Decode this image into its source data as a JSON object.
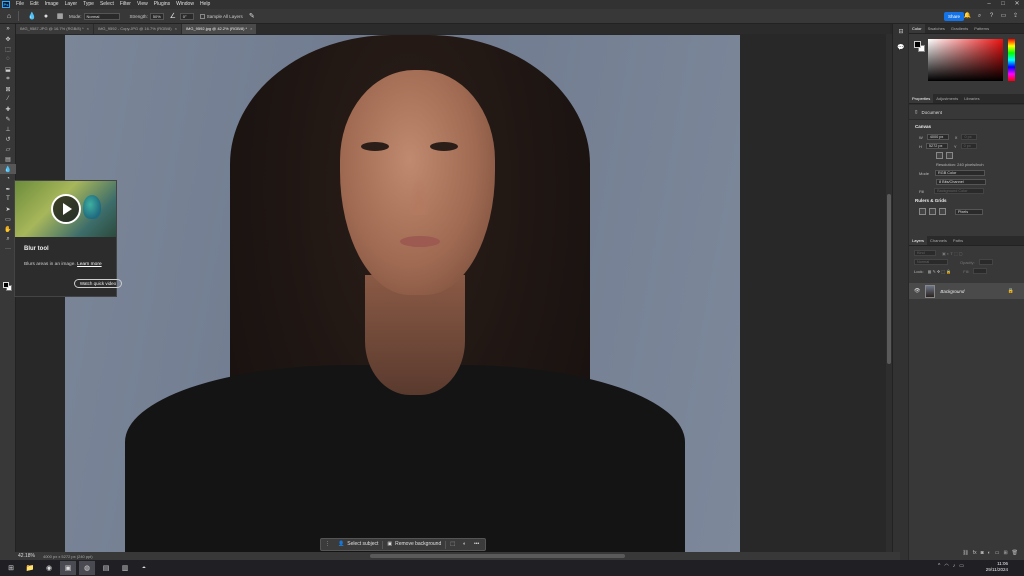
{
  "app": {
    "logo": "Ps"
  },
  "menu": [
    "File",
    "Edit",
    "Image",
    "Layer",
    "Type",
    "Select",
    "Filter",
    "View",
    "Plugins",
    "Window",
    "Help"
  ],
  "window_controls": [
    "–",
    "□",
    "✕"
  ],
  "options": {
    "mode_label": "Mode:",
    "mode_value": "Normal",
    "strength_label": "Strength:",
    "strength_value": "50%",
    "angle_value": "0°",
    "sample_label": "Sample All Layers",
    "share_label": "Share"
  },
  "tabs": [
    {
      "label": "IMG_9587.JPG @ 16.7% (RGB/8) *",
      "active": false
    },
    {
      "label": "IMG_9592 - Copy.JPG @ 16.7% (RGB/8)",
      "active": false
    },
    {
      "label": "IMG_9592.jpg @ 42.2% (RGB/8) *",
      "active": true
    }
  ],
  "tooltip": {
    "title": "Blur tool",
    "description": "Blurs areas in an image.",
    "learn_more": "Learn more",
    "button": "Watch quick video"
  },
  "context_bar": {
    "select_subject": "Select subject",
    "remove_background": "Remove background",
    "more": "•••"
  },
  "status": {
    "zoom": "42.18%",
    "info": "4000 px x 5272 px (240 ppi)"
  },
  "color_panel": {
    "tabs": [
      "Color",
      "Swatches",
      "Gradients",
      "Patterns"
    ],
    "foreground": "#000000",
    "background": "#ffffff"
  },
  "properties": {
    "tabs": [
      "Properties",
      "Adjustments",
      "Libraries"
    ],
    "document_label": "Document",
    "canvas_title": "Canvas",
    "w_label": "W",
    "w_value": "4000 px",
    "h_label": "H",
    "h_value": "5272 px",
    "x_label": "X",
    "y_label": "Y",
    "x_value": "0 px",
    "y_value": "0 px",
    "resolution": "Resolution: 240 pixels/inch",
    "mode_label": "Mode",
    "mode_value": "RGB Color",
    "depth_value": "8 Bits/Channel",
    "fill_label": "Fill",
    "fill_value": "Background Color",
    "rulers_title": "Rulers & Grids",
    "units_value": "Pixels"
  },
  "layers": {
    "tabs": [
      "Layers",
      "Channels",
      "Paths"
    ],
    "kind_placeholder": "Kind",
    "blend_mode": "Normal",
    "opacity_label": "Opacity:",
    "lock_label": "Lock:",
    "fill_label": "Fill:",
    "layer_name": "Background"
  },
  "clock": {
    "time": "11:06",
    "date": "29/11/2024"
  },
  "accent": "#1473e6"
}
